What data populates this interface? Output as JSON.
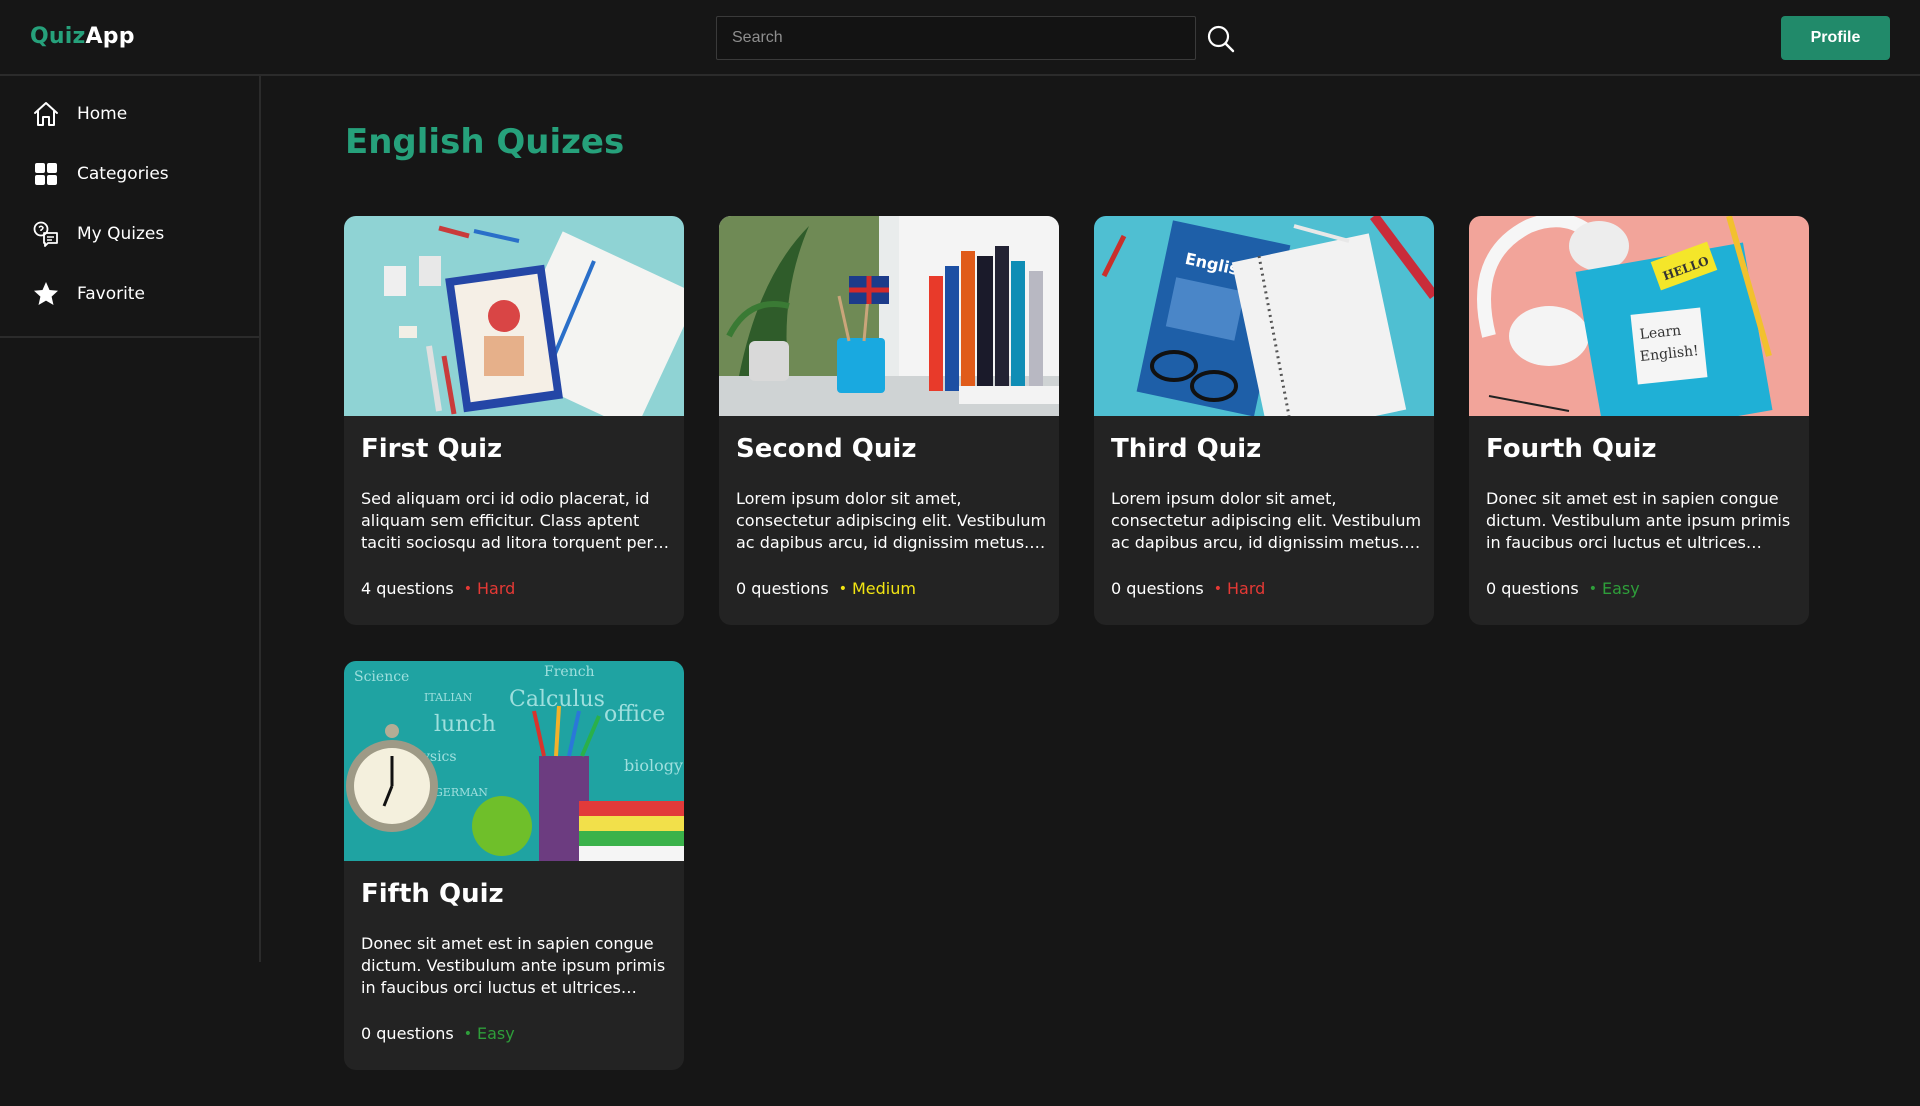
{
  "header": {
    "logo_part1": "Quiz",
    "logo_part2": "App",
    "search_placeholder": "Search",
    "profile_label": "Profile"
  },
  "sidebar": {
    "items": [
      {
        "label": "Home",
        "icon": "home-icon"
      },
      {
        "label": "Categories",
        "icon": "grid-icon"
      },
      {
        "label": "My Quizes",
        "icon": "quiz-list-icon"
      },
      {
        "label": "Favorite",
        "icon": "star-icon"
      }
    ]
  },
  "main": {
    "title": "English Quizes",
    "cards": [
      {
        "title": "First Quiz",
        "description": "Sed aliquam orci id odio placerat, id aliquam sem efficitur. Class aptent taciti sociosqu ad litora torquent per conubia nostra.",
        "questions": "4 questions",
        "difficulty": "Hard",
        "difficulty_color": "#e53935"
      },
      {
        "title": "Second Quiz",
        "description": "Lorem ipsum dolor sit amet, consectetur adipiscing elit. Vestibulum ac dapibus arcu, id dignissim metus. Maecenas lacinia.",
        "questions": "0 questions",
        "difficulty": "Medium",
        "difficulty_color": "#f2e512"
      },
      {
        "title": "Third Quiz",
        "description": "Lorem ipsum dolor sit amet, consectetur adipiscing elit. Vestibulum ac dapibus arcu, id dignissim metus. Maecenas lacinia.",
        "questions": "0 questions",
        "difficulty": "Hard",
        "difficulty_color": "#e53935"
      },
      {
        "title": "Fourth Quiz",
        "description": "Donec sit amet est in sapien congue dictum. Vestibulum ante ipsum primis in faucibus orci luctus et ultrices posuere cubilia.",
        "questions": "0 questions",
        "difficulty": "Easy",
        "difficulty_color": "#2e9e3a"
      },
      {
        "title": "Fifth Quiz",
        "description": "Donec sit amet est in sapien congue dictum. Vestibulum ante ipsum primis in faucibus orci luctus et ultrices posuere cubilia.",
        "questions": "0 questions",
        "difficulty": "Easy",
        "difficulty_color": "#2e9e3a"
      }
    ]
  },
  "images": {
    "card1_title": "",
    "card2_flag": "",
    "card3_book": "English",
    "card4_sticky": "HELLO",
    "card4_note_line1": "Learn",
    "card4_note_line2": "English!",
    "card5_board_words": [
      "Science",
      "ITALIAN",
      "lunch",
      "Calculus",
      "office",
      "French",
      "physics",
      "biology",
      "GERMAN"
    ]
  }
}
